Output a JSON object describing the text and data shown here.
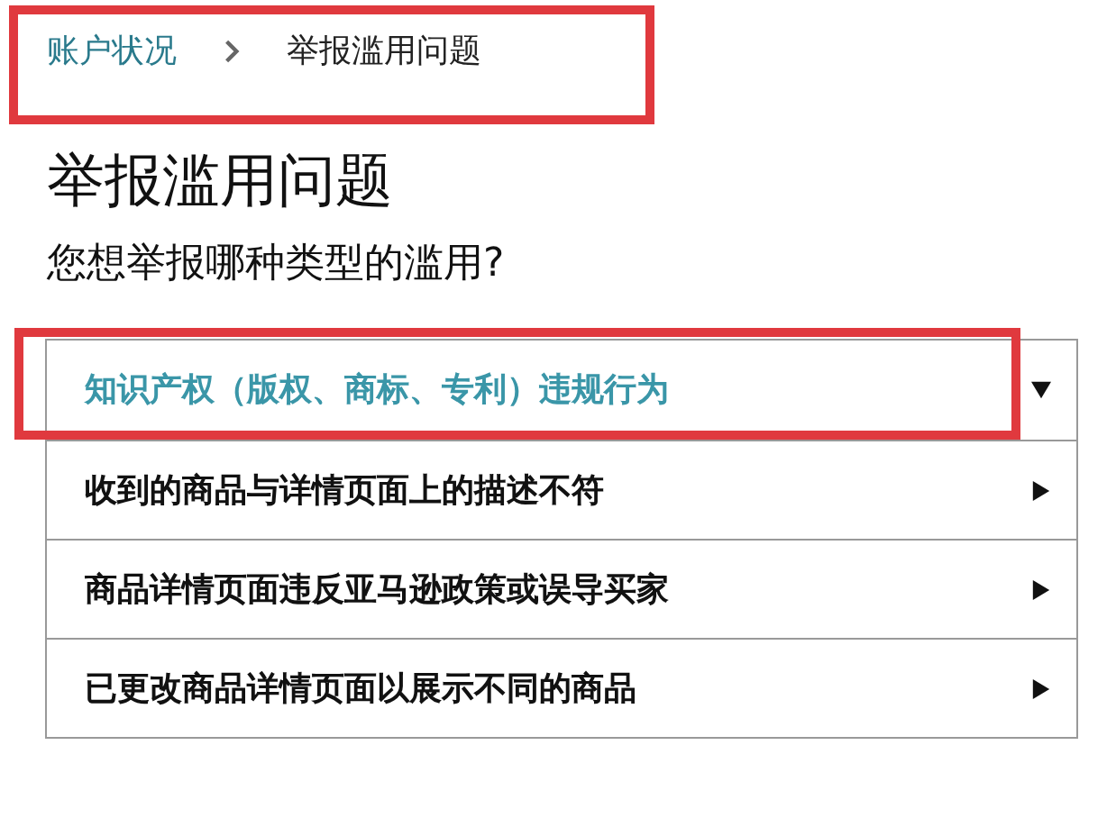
{
  "breadcrumb": {
    "highlighted": true,
    "items": [
      {
        "label": "账户状况",
        "link": true
      },
      {
        "label": "举报滥用问题",
        "link": false
      }
    ]
  },
  "title": "举报滥用问题",
  "question": "您想举报哪种类型的滥用?",
  "options": [
    {
      "label": "知识产权（版权、商标、专利）违规行为",
      "expanded": true,
      "highlighted": true
    },
    {
      "label": "收到的商品与详情页面上的描述不符",
      "expanded": false,
      "highlighted": false
    },
    {
      "label": "商品详情页面违反亚马逊政策或误导买家",
      "expanded": false,
      "highlighted": false
    },
    {
      "label": "已更改商品详情页面以展示不同的商品",
      "expanded": false,
      "highlighted": false
    }
  ]
}
